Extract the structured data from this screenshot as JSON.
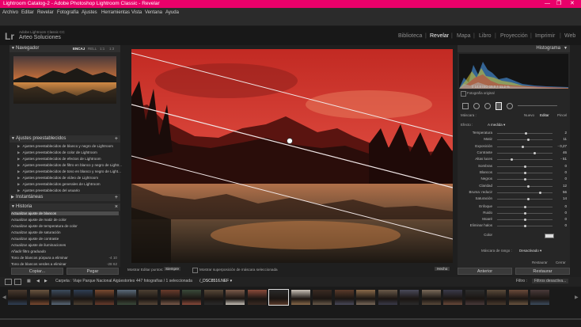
{
  "window": {
    "title": "Lightroom Catalog-2 - Adobe Photoshop Lightroom Classic - Revelar",
    "controls": [
      "—",
      "❐",
      "✕"
    ]
  },
  "menu": [
    "Archivo",
    "Editar",
    "Revelar",
    "Fotografía",
    "Ajustes",
    "Herramientas",
    "Vista",
    "Ventana",
    "Ayuda"
  ],
  "identity": {
    "logo": "Lr",
    "sub": "Adobe Lightroom Classic CC",
    "name": "Arteo Soluciones"
  },
  "modules": [
    {
      "label": "Biblioteca",
      "active": false
    },
    {
      "label": "Revelar",
      "active": true
    },
    {
      "label": "Mapa",
      "active": false
    },
    {
      "label": "Libro",
      "active": false
    },
    {
      "label": "Proyección",
      "active": false
    },
    {
      "label": "Imprimir",
      "active": false
    },
    {
      "label": "Web",
      "active": false
    }
  ],
  "left": {
    "navigator": {
      "title": "Navegador",
      "zoom": [
        {
          "label": "ENCAJ",
          "selected": true
        },
        {
          "label": "RELL",
          "selected": false
        },
        {
          "label": "1:1",
          "selected": false
        },
        {
          "label": "1:3",
          "selected": false
        }
      ]
    },
    "presets": {
      "title": "Ajustes preestablecidos",
      "items": [
        "Ajustes preestablecidos de blanco y negro de Lightroom",
        "Ajustes preestablecidos de color de Lightroom",
        "Ajustes preestablecidos de efectos de Lightroom",
        "Ajustes preestablecidos de filtro en blanco y negro de Lightr...",
        "Ajustes preestablecidos de tono en blanco y negro de Light...",
        "Ajustes preestablecidos de vídeo de Lightroom",
        "Ajustes preestablecidos generales de Lightroom",
        "Ajustes preestablecidos del usuario"
      ]
    },
    "snapshots": {
      "title": "Instantáneas"
    },
    "history": {
      "title": "Historia",
      "items": [
        {
          "label": "Actualizar ajuste de blancos",
          "num": "",
          "selected": true
        },
        {
          "label": "Actualizar ajuste de matiz de color",
          "num": "",
          "selected": false
        },
        {
          "label": "Actualizar ajuste de temperatura de color",
          "num": "",
          "selected": false
        },
        {
          "label": "Actualizar ajuste de saturación",
          "num": "",
          "selected": false
        },
        {
          "label": "Actualizar ajuste de contraste",
          "num": "",
          "selected": false
        },
        {
          "label": "Actualizar ajuste de iluminaciones",
          "num": "",
          "selected": false
        },
        {
          "label": "Añadir filtro graduado",
          "num": "",
          "selected": false
        },
        {
          "label": "Tono de blancos púrpura a eliminar",
          "num": "-4  10",
          "selected": false
        },
        {
          "label": "Tono de blancos verdes a eliminar",
          "num": "-28  62",
          "selected": false
        }
      ]
    },
    "buttons": {
      "copy": "Copiar...",
      "paste": "Pegar"
    }
  },
  "canvas_toolbar": {
    "show_pins_label": "Mostrar Editar puntos:",
    "show_pins_value": "Siempre",
    "overlay_label": "Mostrar superposición de máscara seleccionada",
    "done": "Hecho"
  },
  "right": {
    "histogram": {
      "title": "Histograma",
      "readout": "f/  14,8   ISO  15,0   ƒ   11,2 %",
      "original": "Fotografía original"
    },
    "mask": {
      "label": "Máscara :",
      "new": "Nuevo",
      "edit": "Editar",
      "brush": "Pincel"
    },
    "effect": {
      "label": "Efecto :",
      "value": "A medida ▾"
    },
    "sliders": [
      {
        "label": "Temperatura",
        "value": "2",
        "pos": 0.52
      },
      {
        "label": "Matiz",
        "value": "11",
        "pos": 0.57
      },
      {
        "label": "Exposición",
        "value": "- 0,27",
        "pos": 0.46
      },
      {
        "label": "Contraste",
        "value": "46",
        "pos": 0.68
      },
      {
        "label": "Altas luces",
        "value": "- 51",
        "pos": 0.26
      },
      {
        "label": "Sombras",
        "value": "0",
        "pos": 0.5
      },
      {
        "label": "Blancos",
        "value": "0",
        "pos": 0.5
      },
      {
        "label": "Negros",
        "value": "0",
        "pos": 0.5
      },
      {
        "label": "Claridad",
        "value": "12",
        "pos": 0.56
      },
      {
        "label": "Bruma: reducir",
        "value": "56",
        "pos": 0.78
      },
      {
        "label": "Saturación",
        "value": "14",
        "pos": 0.57
      },
      {
        "label": "Enfoque",
        "value": "0",
        "pos": 0.5
      },
      {
        "label": "Ruido",
        "value": "0",
        "pos": 0.5
      },
      {
        "label": "Moaré",
        "value": "0",
        "pos": 0.5
      },
      {
        "label": "Eliminar halos",
        "value": "0",
        "pos": 0.5
      },
      {
        "label": "Color",
        "value": "",
        "pos": null
      }
    ],
    "range_mask": {
      "label": "Máscara de rango :",
      "value": "Desactivado ▾"
    },
    "reset": "Restaurar",
    "close": "Cerrar",
    "buttons": {
      "previous": "Anterior",
      "restore": "Restaurar"
    }
  },
  "filmbar": {
    "path": "Carpeta : Viaje Parque Nacional Aigüestortes",
    "count": "447 fotografías / 1 seleccionada",
    "file": "/_DSC8516.NEF ▾",
    "filter_label": "Filtro :",
    "filter_value": "Filtros desactiva..."
  },
  "colors": {
    "titlebar": "#e9006a",
    "panel": "#262626",
    "bg": "#1f1f1f",
    "sky_red": "#d6322b",
    "text": "#bdbdbd"
  }
}
